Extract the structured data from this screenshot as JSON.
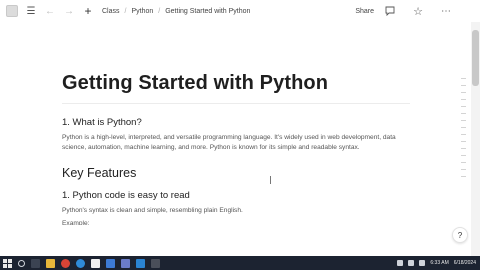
{
  "topbar": {
    "breadcrumbs": [
      "Class",
      "Python",
      "Getting Started with Python"
    ],
    "share_label": "Share"
  },
  "page": {
    "title": "Getting Started with Python",
    "section1_heading": "1. What is Python?",
    "section1_text": "Python is a high-level, interpreted, and versatile programming language. It's widely used in web development, data science, automation, machine learning, and more. Python is known for its simple and readable syntax.",
    "key_features_heading": "Key Features",
    "feature1_heading": "1. Python code is easy to read",
    "feature1_text": "Python's syntax is clean and simple, resembling plain English.",
    "example_label": "Example:"
  },
  "help_button": {
    "label": "?"
  },
  "taskbar": {
    "time": "6:33 AM",
    "date": "6/18/2024"
  }
}
